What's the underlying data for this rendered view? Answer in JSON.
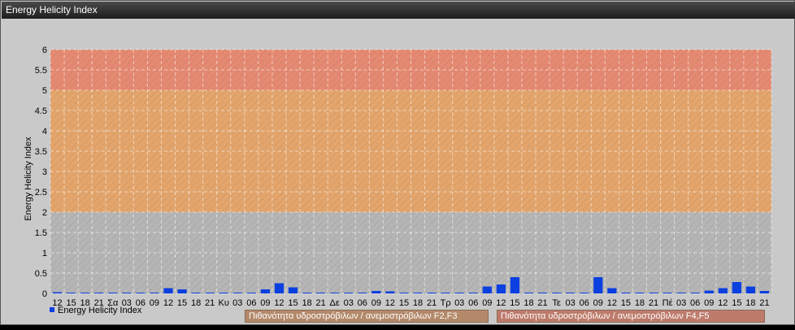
{
  "window": {
    "title": "Energy Helicity Index"
  },
  "colors": {
    "bar": "#0b3fe0",
    "band_gray": "#b5b5b5",
    "band_orange": "#e3a56c",
    "band_red": "#e58a72",
    "legend_f2f3": "#b3896a",
    "legend_f4f5": "#bd7b6b"
  },
  "legend": {
    "series_label": "Energy Helicity Index",
    "f2f3_label": "Πιθανότητα υδροστρόβιλων / ανεμοστρόβιλων F2,F3",
    "f4f5_label": "Πιθανότητα υδροστρόβιλων / ανεμοστρόβιλων F4,F5"
  },
  "chart_data": {
    "type": "bar",
    "ylabel": "Energy Helicity Index",
    "ylim": [
      0,
      6
    ],
    "yticks": [
      "0",
      "0.5",
      "1",
      "1.5",
      "2",
      "2.5",
      "3",
      "3.5",
      "4",
      "4.5",
      "5",
      "5.5",
      "6"
    ],
    "bands": [
      {
        "from": 0,
        "to": 2,
        "color": "#b5b5b5"
      },
      {
        "from": 2,
        "to": 5,
        "color": "#e3a56c"
      },
      {
        "from": 5,
        "to": 6,
        "color": "#e58a72"
      }
    ],
    "categories": [
      "12",
      "15",
      "18",
      "21",
      "Σα",
      "03",
      "06",
      "09",
      "12",
      "15",
      "18",
      "21",
      "Κυ",
      "03",
      "06",
      "09",
      "12",
      "15",
      "18",
      "21",
      "Δε",
      "03",
      "06",
      "09",
      "12",
      "15",
      "18",
      "21",
      "Τρ",
      "03",
      "06",
      "09",
      "12",
      "15",
      "18",
      "21",
      "Τε",
      "03",
      "06",
      "09",
      "12",
      "15",
      "18",
      "21",
      "Πέ",
      "03",
      "06",
      "09",
      "12",
      "15",
      "18",
      "21"
    ],
    "values": [
      0.03,
      0.02,
      0.02,
      0.02,
      0.02,
      0.02,
      0.02,
      0.02,
      0.13,
      0.1,
      0.02,
      0.02,
      0.02,
      0.02,
      0.02,
      0.1,
      0.25,
      0.15,
      0.02,
      0.02,
      0.02,
      0.02,
      0.02,
      0.06,
      0.05,
      0.02,
      0.02,
      0.02,
      0.02,
      0.02,
      0.02,
      0.17,
      0.22,
      0.4,
      0.02,
      0.02,
      0.02,
      0.02,
      0.02,
      0.4,
      0.13,
      0.02,
      0.02,
      0.02,
      0.02,
      0.02,
      0.02,
      0.07,
      0.13,
      0.28,
      0.17,
      0.06
    ],
    "grid": true,
    "legend_position": "bottom"
  }
}
